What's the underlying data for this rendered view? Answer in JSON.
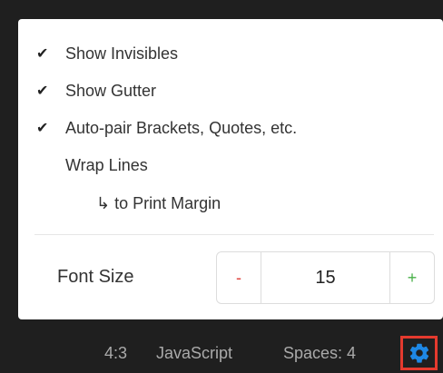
{
  "settings": {
    "options": [
      {
        "label": "Show Invisibles",
        "checked": true,
        "mark": "✔"
      },
      {
        "label": "Show Gutter",
        "checked": true,
        "mark": "✔"
      },
      {
        "label": "Auto-pair Brackets, Quotes, etc.",
        "checked": true,
        "mark": "✔"
      },
      {
        "label": "Wrap Lines",
        "checked": false,
        "mark": ""
      },
      {
        "label": "↳ to Print Margin",
        "checked": false,
        "mark": ""
      }
    ],
    "font_size": {
      "label": "Font Size",
      "decrement_label": "-",
      "increment_label": "+",
      "value": "15"
    }
  },
  "status_bar": {
    "cursor_position": "4:3",
    "language": "JavaScript",
    "indentation": "Spaces: 4",
    "settings_icon": "gear-icon"
  },
  "colors": {
    "background": "#1f1f1f",
    "panel": "#ffffff",
    "minus": "#e0403a",
    "plus": "#48b048",
    "gear": "#1e88e5",
    "highlight_border": "#e53a2e",
    "status_text": "#aaaaaa"
  }
}
